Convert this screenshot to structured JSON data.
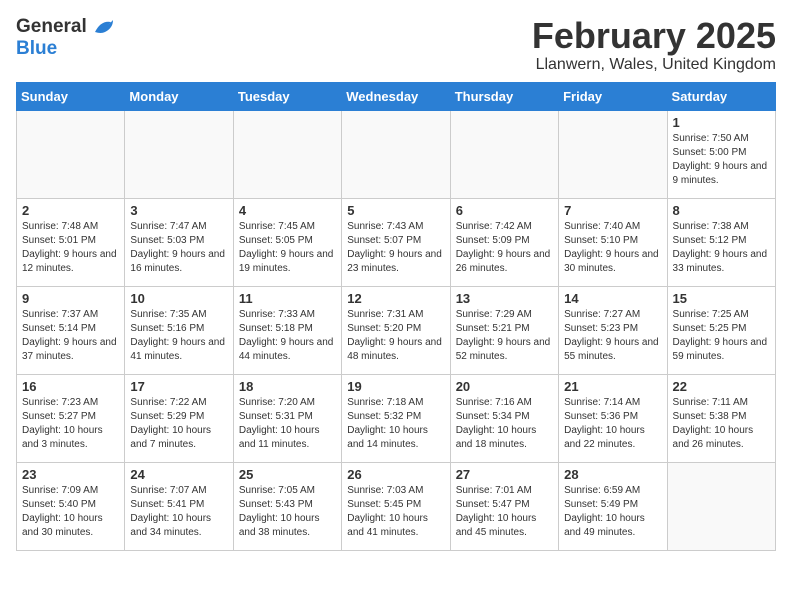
{
  "header": {
    "logo_line1": "General",
    "logo_line2": "Blue",
    "month_title": "February 2025",
    "location": "Llanwern, Wales, United Kingdom"
  },
  "days_of_week": [
    "Sunday",
    "Monday",
    "Tuesday",
    "Wednesday",
    "Thursday",
    "Friday",
    "Saturday"
  ],
  "weeks": [
    [
      {
        "day": "",
        "info": ""
      },
      {
        "day": "",
        "info": ""
      },
      {
        "day": "",
        "info": ""
      },
      {
        "day": "",
        "info": ""
      },
      {
        "day": "",
        "info": ""
      },
      {
        "day": "",
        "info": ""
      },
      {
        "day": "1",
        "info": "Sunrise: 7:50 AM\nSunset: 5:00 PM\nDaylight: 9 hours and 9 minutes."
      }
    ],
    [
      {
        "day": "2",
        "info": "Sunrise: 7:48 AM\nSunset: 5:01 PM\nDaylight: 9 hours and 12 minutes."
      },
      {
        "day": "3",
        "info": "Sunrise: 7:47 AM\nSunset: 5:03 PM\nDaylight: 9 hours and 16 minutes."
      },
      {
        "day": "4",
        "info": "Sunrise: 7:45 AM\nSunset: 5:05 PM\nDaylight: 9 hours and 19 minutes."
      },
      {
        "day": "5",
        "info": "Sunrise: 7:43 AM\nSunset: 5:07 PM\nDaylight: 9 hours and 23 minutes."
      },
      {
        "day": "6",
        "info": "Sunrise: 7:42 AM\nSunset: 5:09 PM\nDaylight: 9 hours and 26 minutes."
      },
      {
        "day": "7",
        "info": "Sunrise: 7:40 AM\nSunset: 5:10 PM\nDaylight: 9 hours and 30 minutes."
      },
      {
        "day": "8",
        "info": "Sunrise: 7:38 AM\nSunset: 5:12 PM\nDaylight: 9 hours and 33 minutes."
      }
    ],
    [
      {
        "day": "9",
        "info": "Sunrise: 7:37 AM\nSunset: 5:14 PM\nDaylight: 9 hours and 37 minutes."
      },
      {
        "day": "10",
        "info": "Sunrise: 7:35 AM\nSunset: 5:16 PM\nDaylight: 9 hours and 41 minutes."
      },
      {
        "day": "11",
        "info": "Sunrise: 7:33 AM\nSunset: 5:18 PM\nDaylight: 9 hours and 44 minutes."
      },
      {
        "day": "12",
        "info": "Sunrise: 7:31 AM\nSunset: 5:20 PM\nDaylight: 9 hours and 48 minutes."
      },
      {
        "day": "13",
        "info": "Sunrise: 7:29 AM\nSunset: 5:21 PM\nDaylight: 9 hours and 52 minutes."
      },
      {
        "day": "14",
        "info": "Sunrise: 7:27 AM\nSunset: 5:23 PM\nDaylight: 9 hours and 55 minutes."
      },
      {
        "day": "15",
        "info": "Sunrise: 7:25 AM\nSunset: 5:25 PM\nDaylight: 9 hours and 59 minutes."
      }
    ],
    [
      {
        "day": "16",
        "info": "Sunrise: 7:23 AM\nSunset: 5:27 PM\nDaylight: 10 hours and 3 minutes."
      },
      {
        "day": "17",
        "info": "Sunrise: 7:22 AM\nSunset: 5:29 PM\nDaylight: 10 hours and 7 minutes."
      },
      {
        "day": "18",
        "info": "Sunrise: 7:20 AM\nSunset: 5:31 PM\nDaylight: 10 hours and 11 minutes."
      },
      {
        "day": "19",
        "info": "Sunrise: 7:18 AM\nSunset: 5:32 PM\nDaylight: 10 hours and 14 minutes."
      },
      {
        "day": "20",
        "info": "Sunrise: 7:16 AM\nSunset: 5:34 PM\nDaylight: 10 hours and 18 minutes."
      },
      {
        "day": "21",
        "info": "Sunrise: 7:14 AM\nSunset: 5:36 PM\nDaylight: 10 hours and 22 minutes."
      },
      {
        "day": "22",
        "info": "Sunrise: 7:11 AM\nSunset: 5:38 PM\nDaylight: 10 hours and 26 minutes."
      }
    ],
    [
      {
        "day": "23",
        "info": "Sunrise: 7:09 AM\nSunset: 5:40 PM\nDaylight: 10 hours and 30 minutes."
      },
      {
        "day": "24",
        "info": "Sunrise: 7:07 AM\nSunset: 5:41 PM\nDaylight: 10 hours and 34 minutes."
      },
      {
        "day": "25",
        "info": "Sunrise: 7:05 AM\nSunset: 5:43 PM\nDaylight: 10 hours and 38 minutes."
      },
      {
        "day": "26",
        "info": "Sunrise: 7:03 AM\nSunset: 5:45 PM\nDaylight: 10 hours and 41 minutes."
      },
      {
        "day": "27",
        "info": "Sunrise: 7:01 AM\nSunset: 5:47 PM\nDaylight: 10 hours and 45 minutes."
      },
      {
        "day": "28",
        "info": "Sunrise: 6:59 AM\nSunset: 5:49 PM\nDaylight: 10 hours and 49 minutes."
      },
      {
        "day": "",
        "info": ""
      }
    ]
  ]
}
